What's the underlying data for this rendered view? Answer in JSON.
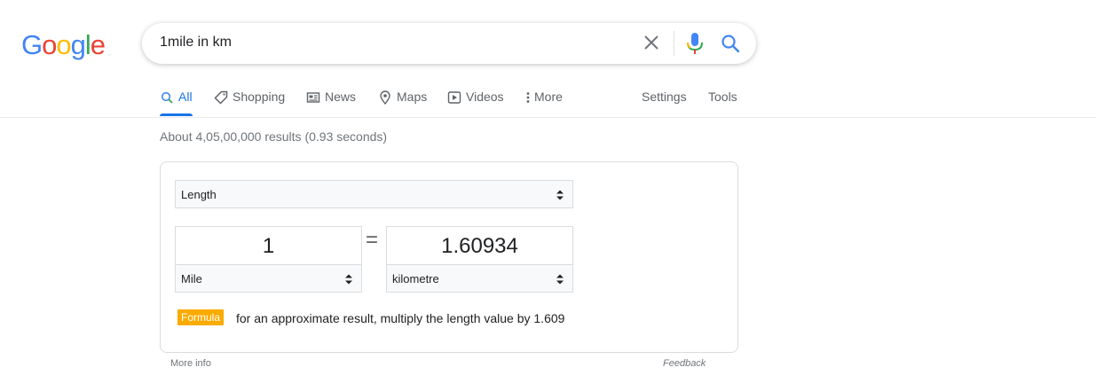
{
  "logo": {
    "letters": [
      "G",
      "o",
      "o",
      "g",
      "l",
      "e"
    ],
    "colors": [
      "#4285F4",
      "#EA4335",
      "#FBBC05",
      "#4285F4",
      "#34A853",
      "#EA4335"
    ]
  },
  "search": {
    "query": "1mile in km"
  },
  "tabs": [
    {
      "label": "All",
      "icon": "search-icon",
      "active": true
    },
    {
      "label": "Shopping",
      "icon": "tag-icon"
    },
    {
      "label": "News",
      "icon": "news-icon"
    },
    {
      "label": "Maps",
      "icon": "map-pin-icon"
    },
    {
      "label": "Videos",
      "icon": "play-icon"
    },
    {
      "label": "More",
      "icon": "more-vert-icon"
    }
  ],
  "tools": {
    "settings": "Settings",
    "tools": "Tools"
  },
  "result_stats": "About 4,05,00,000 results (0.93 seconds)",
  "converter": {
    "unit_type": "Length",
    "from_value": "1",
    "from_unit": "Mile",
    "equals": "=",
    "to_value": "1.60934",
    "to_unit": "kilometre",
    "formula_label": "Formula",
    "formula_text": "for an approximate result, multiply the length value by 1.609"
  },
  "footer": {
    "more_info": "More info",
    "feedback": "Feedback"
  },
  "accent_color": "#1a73e8"
}
